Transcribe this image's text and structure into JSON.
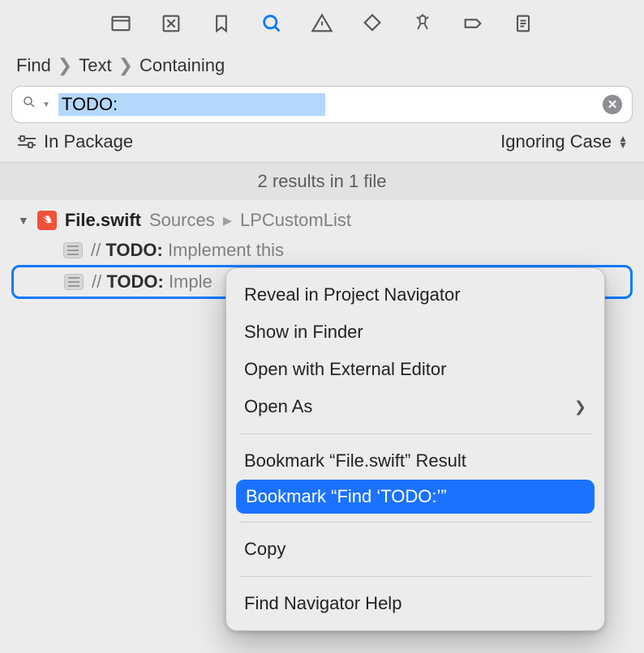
{
  "breadcrumb": {
    "a": "Find",
    "b": "Text",
    "c": "Containing"
  },
  "search": {
    "query": "TODO:"
  },
  "scope": {
    "label": "In Package",
    "case": "Ignoring Case"
  },
  "results_banner": "2 results in 1 file",
  "file": {
    "name": "File.swift",
    "path_a": "Sources",
    "path_b": "LPCustomList"
  },
  "results": [
    {
      "prefix": "// ",
      "todo": "TODO:",
      "rest": " Implement this"
    },
    {
      "prefix": "// ",
      "todo": "TODO:",
      "rest": " Imple"
    }
  ],
  "menu": {
    "reveal": "Reveal in Project Navigator",
    "finder": "Show in Finder",
    "external": "Open with External Editor",
    "openas": "Open As",
    "bookmark_result": "Bookmark “File.swift” Result",
    "bookmark_find": "Bookmark “Find ‘TODO:’”",
    "copy": "Copy",
    "help": "Find Navigator Help"
  }
}
